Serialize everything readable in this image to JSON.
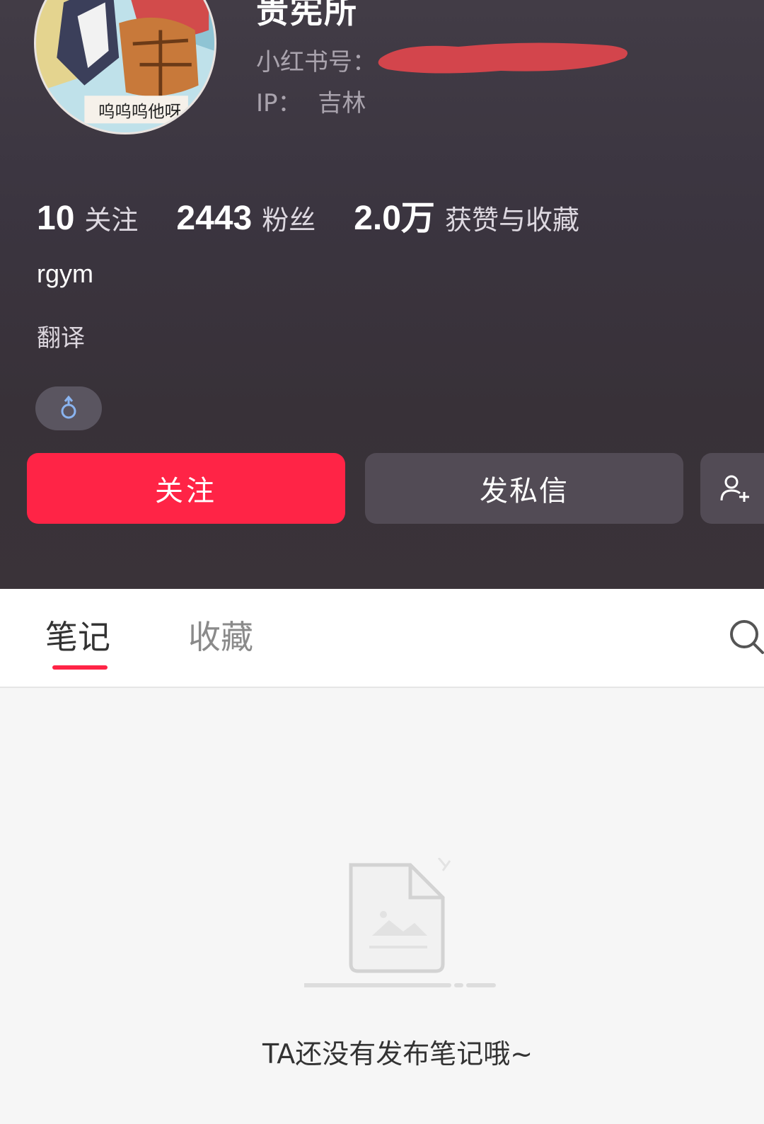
{
  "profile": {
    "nickname": "贵宪所",
    "account_label": "小红书号：",
    "ip_label": "IP：",
    "ip_value": "吉林",
    "avatar_caption": "呜呜呜他呀"
  },
  "stats": [
    {
      "num": "10",
      "label": "关注"
    },
    {
      "num": "2443",
      "label": "粉丝"
    },
    {
      "num": "2.0万",
      "label": "获赞与收藏"
    }
  ],
  "bio": {
    "handle": "rgym",
    "text": "翻译",
    "gender_symbol": "♂"
  },
  "actions": {
    "follow": "关注",
    "message": "发私信"
  },
  "tabs": [
    {
      "label": "笔记",
      "active": true
    },
    {
      "label": "收藏",
      "active": false
    }
  ],
  "empty_state": {
    "message": "TA还没有发布笔记哦~"
  },
  "colors": {
    "accent": "#ff2446",
    "header_bg": "#3b3540",
    "button_secondary": "#524b55"
  }
}
